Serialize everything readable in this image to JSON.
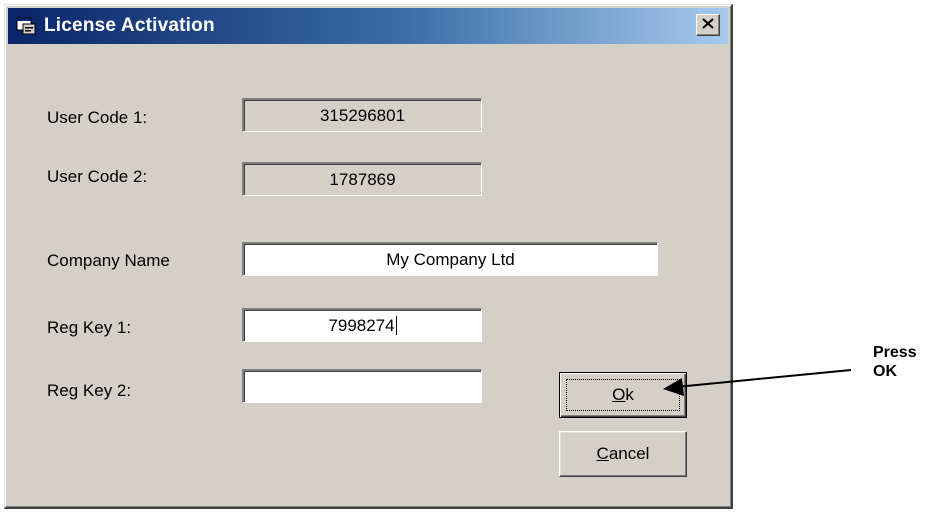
{
  "window": {
    "title": "License Activation",
    "icon": "app-window-icon",
    "close_glyph": "close-icon"
  },
  "form": {
    "user_code_1": {
      "label": "User Code 1:",
      "value": "315296801"
    },
    "user_code_2": {
      "label": "User Code 2:",
      "value": "1787869"
    },
    "company_name": {
      "label": "Company Name",
      "value": "My Company Ltd"
    },
    "reg_key_1": {
      "label": "Reg Key 1:",
      "value": "7998274"
    },
    "reg_key_2": {
      "label": "Reg Key 2:",
      "value": ""
    }
  },
  "buttons": {
    "ok": {
      "mnemonic": "O",
      "rest": "k"
    },
    "cancel": {
      "mnemonic": "C",
      "rest": "ancel"
    }
  },
  "annotation": {
    "line1": "Press",
    "line2": "OK"
  },
  "colors": {
    "dialog_face": "#d4d0c8",
    "titlebar_start": "#0a246a",
    "titlebar_end": "#a6caf0"
  }
}
